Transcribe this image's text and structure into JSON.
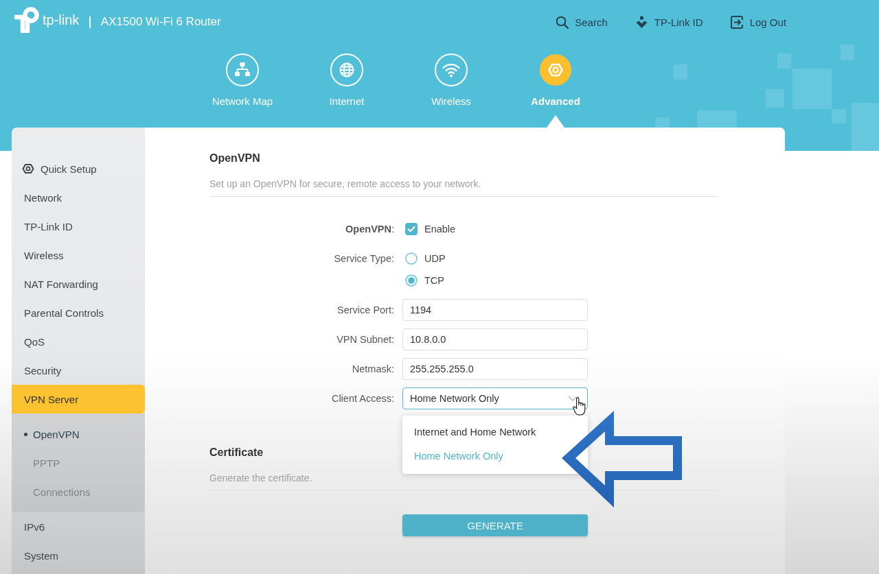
{
  "header": {
    "logo": "tp-link",
    "model": "AX1500 Wi-Fi 6 Router",
    "links": [
      {
        "kind": "search",
        "label": "Search"
      },
      {
        "kind": "account",
        "label": "TP-Link ID"
      },
      {
        "kind": "logout",
        "label": "Log Out"
      }
    ]
  },
  "main_nav": [
    {
      "kind": "network_map",
      "label": "Network Map",
      "selected": false
    },
    {
      "kind": "internet",
      "label": "Internet",
      "selected": false
    },
    {
      "kind": "wireless",
      "label": "Wireless",
      "selected": false
    },
    {
      "kind": "advanced",
      "label": "Advanced",
      "selected": true
    }
  ],
  "sidebar": {
    "quick_setup": "Quick Setup",
    "items": [
      {
        "label": "Network",
        "selected": false
      },
      {
        "label": "TP-Link ID",
        "selected": false
      },
      {
        "label": "Wireless",
        "selected": false
      },
      {
        "label": "NAT Forwarding",
        "selected": false
      },
      {
        "label": "Parental Controls",
        "selected": false
      },
      {
        "label": "QoS",
        "selected": false
      },
      {
        "label": "Security",
        "selected": false
      },
      {
        "label": "VPN Server",
        "selected": true,
        "expanded": true,
        "children": [
          {
            "label": "OpenVPN",
            "selected": true
          },
          {
            "label": "PPTP",
            "selected": false
          },
          {
            "label": "Connections",
            "selected": false
          }
        ]
      },
      {
        "label": "IPv6",
        "selected": false
      },
      {
        "label": "System",
        "selected": false
      }
    ]
  },
  "openvpn": {
    "title": "OpenVPN",
    "description": "Set up an OpenVPN for secure, remote access to your network.",
    "fields": [
      {
        "kind": "checkbox",
        "label": "**OpenVPN**:",
        "option": "Enable",
        "checked": true
      },
      {
        "kind": "radio",
        "label": "Service Type:",
        "options": [
          {
            "label": "UDP",
            "selected": false
          },
          {
            "label": "TCP",
            "selected": true
          }
        ]
      },
      {
        "kind": "text",
        "label": "Service Port:",
        "value": "1194"
      },
      {
        "kind": "text",
        "label": "VPN Subnet:",
        "value": "10.8.0.0"
      },
      {
        "kind": "text",
        "label": "Netmask:",
        "value": "255.255.255.0"
      },
      {
        "kind": "select",
        "label": "Client Access:",
        "value": "Home Network Only",
        "expanded": true,
        "options": [
          {
            "label": "Internet and Home Network",
            "selected": false
          },
          {
            "label": "Home Network Only",
            "selected": true
          }
        ]
      }
    ]
  },
  "certificate": {
    "title": "Certificate",
    "description": "Generate the certificate.",
    "button": "GENERATE"
  }
}
